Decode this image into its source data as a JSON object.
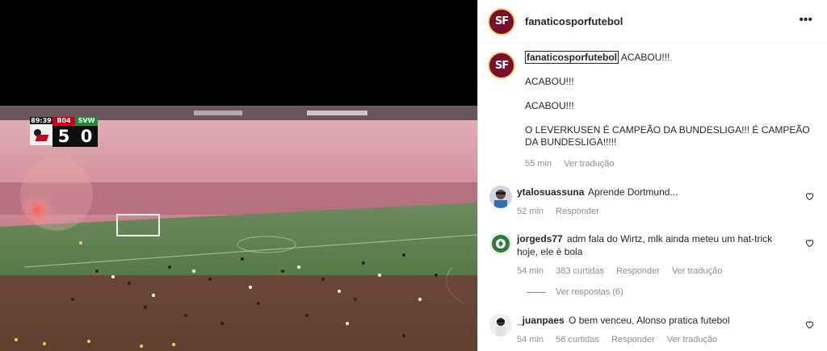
{
  "media": {
    "scorebug": {
      "clock": "89:39",
      "home": {
        "abbr": "B04",
        "score": "5"
      },
      "away": {
        "abbr": "SVW",
        "score": "0"
      }
    }
  },
  "post": {
    "author": "fanaticosporfutebol",
    "author_initials": "SF",
    "more_label": "•••",
    "caption": {
      "user": "fanaticosporfutebol",
      "line1": "ACABOU!!!",
      "line2": "ACABOU!!!",
      "line3": "ACABOU!!!",
      "line4": "O LEVERKUSEN É CAMPEÃO DA BUNDESLIGA!!! É CAMPEÃO DA BUNDESLIGA!!!!!",
      "time": "55 min",
      "translate": "Ver tradução"
    },
    "comments": [
      {
        "user": "ytalosuassuna",
        "text": "Aprende Dortmund...",
        "time": "52 min",
        "likes": "",
        "reply": "Responder",
        "translate": ""
      },
      {
        "user": "jorgeds77",
        "text": "adm fala do Wirtz, mlk ainda meteu um hat-trick hoje, ele é bola",
        "time": "54 min",
        "likes": "383 curtidas",
        "reply": "Responder",
        "translate": "Ver tradução"
      },
      {
        "user": "_juanpaes",
        "text": "O bem venceu, Alonso pratica futebol",
        "time": "54 min",
        "likes": "56 curtidas",
        "reply": "Responder",
        "translate": "Ver tradução"
      }
    ],
    "view_replies": "Ver respostas (6)"
  },
  "colors": {
    "accent_red": "#c9001c",
    "pitch_green": "#3d6a34",
    "smoke_pink": "#d98a96",
    "meta_gray": "#8e8e8e"
  },
  "icons": {
    "more": "more-options-icon",
    "heart": "heart-icon"
  }
}
